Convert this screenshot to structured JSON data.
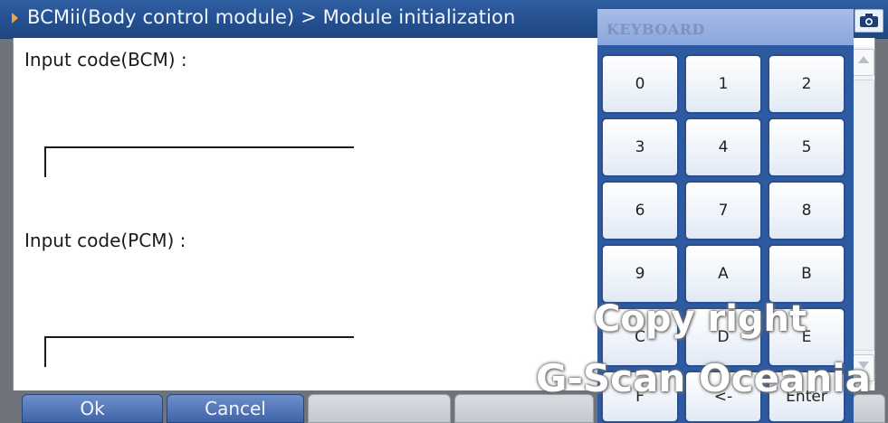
{
  "title_bar": {
    "breadcrumb": "BCMii(Body control module) > Module initialization",
    "camera_icon": "camera-icon"
  },
  "form": {
    "bcm_label": "Input code(BCM) :",
    "bcm_value": "",
    "pcm_label": "Input code(PCM) :",
    "pcm_value": ""
  },
  "keyboard": {
    "title": "KEYBOARD",
    "keys": [
      "0",
      "1",
      "2",
      "3",
      "4",
      "5",
      "6",
      "7",
      "8",
      "9",
      "A",
      "B",
      "C",
      "D",
      "E",
      "F",
      "<-",
      "Enter"
    ]
  },
  "toolbar": {
    "ok_label": "Ok",
    "cancel_label": "Cancel"
  },
  "watermark": {
    "line1": "Copy right",
    "line2": "G-Scan Oceania"
  },
  "colors": {
    "title_bar": "#2a5596",
    "keyboard_border": "#2a4f90",
    "active_button": "#4a6fb2",
    "arrow": "#f3a33a"
  }
}
